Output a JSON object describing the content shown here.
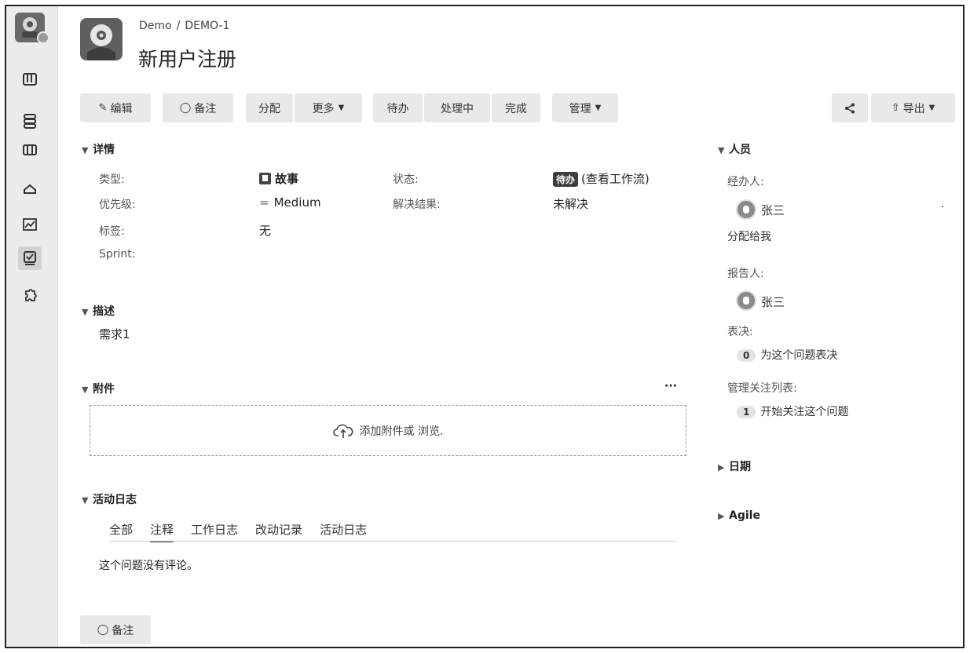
{
  "breadcrumb": {
    "project": "Demo",
    "separator": "/",
    "issue_key": "DEMO-1"
  },
  "page_title": "新用户注册",
  "toolbar": {
    "edit": "编辑",
    "comment": "备注",
    "assign": "分配",
    "more": "更多",
    "todo": "待办",
    "in_progress": "处理中",
    "done": "完成",
    "manage": "管理",
    "export": "导出"
  },
  "details": {
    "title": "详情",
    "type_label": "类型:",
    "type_value": "故事",
    "status_label": "状态:",
    "status_badge": "待办",
    "status_link": "(查看工作流)",
    "priority_label": "优先级:",
    "priority_value": "Medium",
    "resolution_label": "解决结果:",
    "resolution_value": "未解决",
    "tags_label": "标签:",
    "tags_value": "无",
    "sprint_label": "Sprint:"
  },
  "description": {
    "title": "描述",
    "text": "需求1"
  },
  "attachments": {
    "title": "附件",
    "more": "···",
    "drop_text": "添加附件或 浏览."
  },
  "activity": {
    "title": "活动日志",
    "tabs": [
      "全部",
      "注释",
      "工作日志",
      "改动记录",
      "活动日志"
    ],
    "empty": "这个问题没有评论。",
    "comment_button": "备注"
  },
  "people": {
    "title": "人员",
    "assignee_label": "经办人:",
    "assignee_name": "张三",
    "assign_to_me": "分配给我",
    "reporter_label": "报告人:",
    "reporter_name": "张三",
    "votes_label": "表决:",
    "votes_count": "0",
    "votes_text": "为这个问题表决",
    "watchers_label": "管理关注列表:",
    "watchers_count": "1",
    "watchers_text": "开始关注这个问题",
    "dot": "·"
  },
  "dates": {
    "title": "日期"
  },
  "agile": {
    "title": "Agile"
  }
}
